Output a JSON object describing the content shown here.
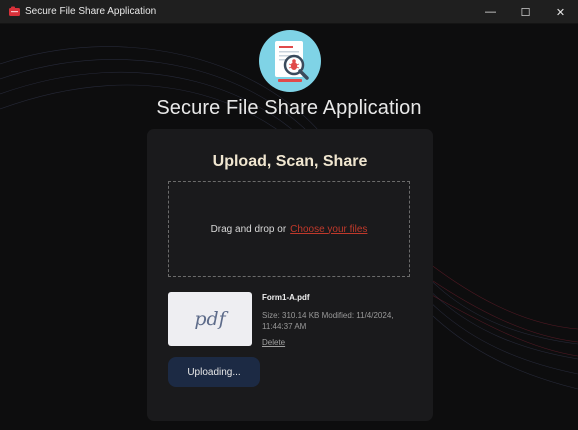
{
  "window": {
    "title": "Secure File Share Application",
    "controls": {
      "minimize": "—",
      "maximize": "☐",
      "close": "✕"
    }
  },
  "header": {
    "title": "Secure File Share Application",
    "logo_icon": "document-scan-bug-icon"
  },
  "card": {
    "title": "Upload, Scan, Share",
    "dropzone": {
      "text": "Drag and drop or",
      "link": "Choose your files"
    },
    "file": {
      "thumbnail_text": "pdf",
      "name": "Form1-A.pdf",
      "meta": "Size: 310.14 KB   Modified: 11/4/2024, 11:44:37 AM",
      "delete_label": "Delete"
    },
    "upload_button": "Uploading..."
  },
  "colors": {
    "background": "#0d0d0e",
    "card": "#1a1a1c",
    "accent_link": "#c0392b",
    "button": "#1c2a44"
  }
}
